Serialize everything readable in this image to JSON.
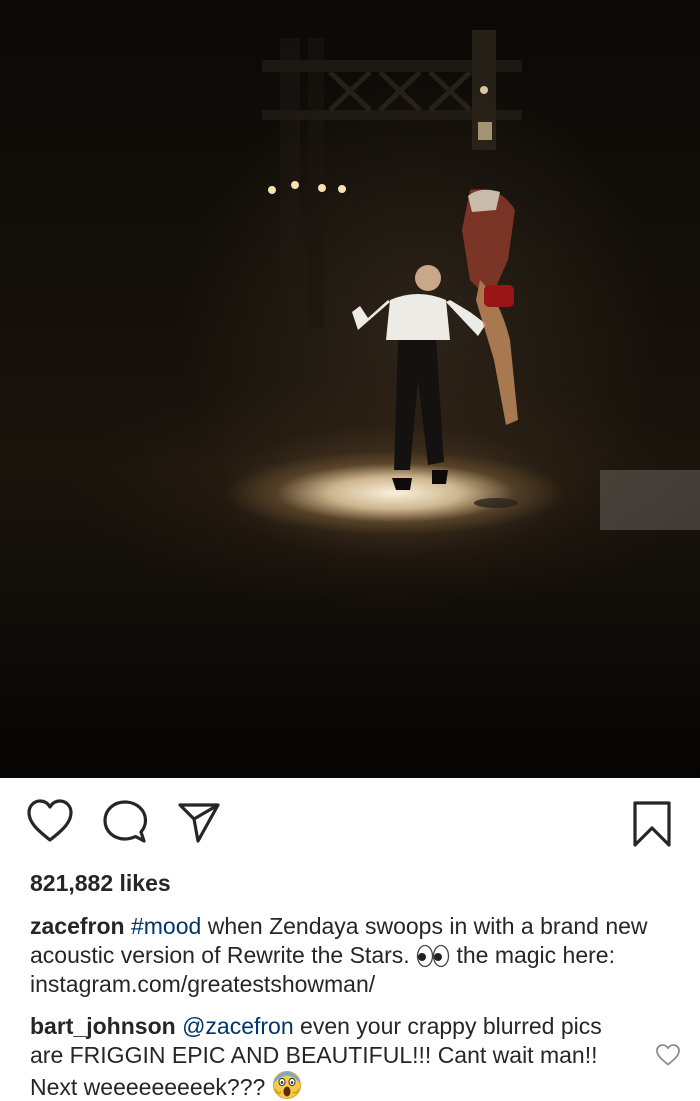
{
  "post": {
    "photo_alt": "",
    "actions": {
      "like_icon": "heart-outline-icon",
      "comment_icon": "comment-bubble-icon",
      "share_icon": "paper-plane-icon",
      "save_icon": "bookmark-outline-icon"
    },
    "likes_text": "821,882 likes",
    "caption": {
      "username": "zacefron",
      "hashtag": "#mood",
      "text": " when Zendaya swoops in with a brand new acoustic version of Rewrite the Stars.",
      "emoji": "eyes-emoji",
      "text_after": " the magic here: instagram.com/greatestshowman/"
    },
    "comment": {
      "username": "bart_johnson",
      "mention": "@zacefron",
      "text": " even your crappy blurred pics are FRIGGIN EPIC AND BEAUTIFUL!!! Cant wait man!! Next weeeeeeeeek???",
      "emoji": "face-screaming-emoji",
      "like_icon": "small-heart-outline-icon"
    }
  },
  "colors": {
    "text": "#262626",
    "link": "#003569",
    "background": "#ffffff"
  }
}
